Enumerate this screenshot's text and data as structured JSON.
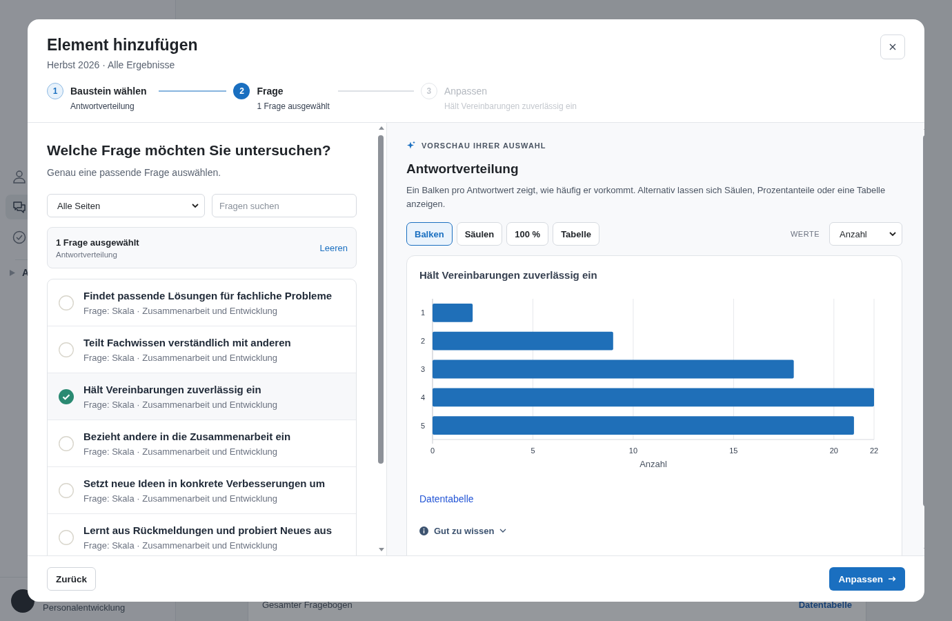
{
  "background": {
    "nav": [
      {
        "selected": false
      },
      {
        "selected": true
      },
      {
        "selected": false
      }
    ],
    "section_label": "A",
    "profile_name": "Personalentwicklung",
    "card_label": "Gesamter Fragebogen",
    "card_link": "Datentabelle"
  },
  "dialog": {
    "title": "Element hinzufügen",
    "subtitle": "Herbst 2026 · Alle Ergebnisse",
    "steps": [
      {
        "number": "1",
        "label": "Baustein wählen",
        "detail": "Antwortverteilung",
        "completed": true,
        "selected": false
      },
      {
        "number": "2",
        "label": "Frage",
        "detail": "1 Frage ausgewählt",
        "completed": false,
        "selected": true
      },
      {
        "number": "3",
        "label": "Anpassen",
        "detail": "Hält Vereinbarungen zuverlässig ein",
        "completed": false,
        "selected": false
      }
    ]
  },
  "question_panel": {
    "heading": "Welche Frage möchten Sie untersuchen?",
    "hint": "Genau eine passende Frage auswählen.",
    "page_filter": {
      "value": "Alle Seiten"
    },
    "search": {
      "placeholder": "Fragen suchen"
    },
    "selection_summary": {
      "title": "1 Frage ausgewählt",
      "detail": "Antwortverteilung",
      "action": "Leeren"
    },
    "questions": [
      {
        "title": "Findet passende Lösungen für fachliche Probleme",
        "meta": "Frage: Skala · Zusammenarbeit und Entwicklung",
        "selected": false
      },
      {
        "title": "Teilt Fachwissen verständlich mit anderen",
        "meta": "Frage: Skala · Zusammenarbeit und Entwicklung",
        "selected": false
      },
      {
        "title": "Hält Vereinbarungen zuverlässig ein",
        "meta": "Frage: Skala · Zusammenarbeit und Entwicklung",
        "selected": true
      },
      {
        "title": "Bezieht andere in die Zusammenarbeit ein",
        "meta": "Frage: Skala · Zusammenarbeit und Entwicklung",
        "selected": false
      },
      {
        "title": "Setzt neue Ideen in konkrete Verbesserungen um",
        "meta": "Frage: Skala · Zusammenarbeit und Entwicklung",
        "selected": false
      },
      {
        "title": "Lernt aus Rückmeldungen und probiert Neues aus",
        "meta": "Frage: Skala · Zusammenarbeit und Entwicklung",
        "selected": false
      }
    ]
  },
  "preview": {
    "eyebrow": "VORSCHAU IHRER AUSWAHL",
    "title": "Antwortverteilung",
    "description": "Ein Balken pro Antwortwert zeigt, wie häufig er vorkommt. Alternativ lassen sich Säulen, Prozentanteile oder eine Tabelle anzeigen.",
    "view_options": [
      {
        "label": "Balken",
        "selected": true
      },
      {
        "label": "Säulen",
        "selected": false
      },
      {
        "label": "100 %",
        "selected": false
      },
      {
        "label": "Tabelle",
        "selected": false
      }
    ],
    "values_label": "WERTE",
    "values_select": {
      "value": "Anzahl"
    },
    "chart_card": {
      "chart_data": {
        "type": "bar",
        "orientation": "horizontal",
        "title": "Hält Vereinbarungen zuverlässig ein",
        "xlabel": "Anzahl",
        "categories": [
          "1",
          "2",
          "3",
          "4",
          "5"
        ],
        "series": [
          {
            "color": "#1f6fb8",
            "values": [
              2,
              9,
              18,
              22,
              21
            ]
          }
        ],
        "grid": true,
        "xlim": [
          0,
          22
        ],
        "xticks": [
          0,
          5,
          10,
          15,
          20,
          22
        ]
      }
    },
    "table_link": "Datentabelle",
    "info_toggle": "Gut zu wissen"
  },
  "footer": {
    "back": "Zurück",
    "next": "Anpassen"
  }
}
